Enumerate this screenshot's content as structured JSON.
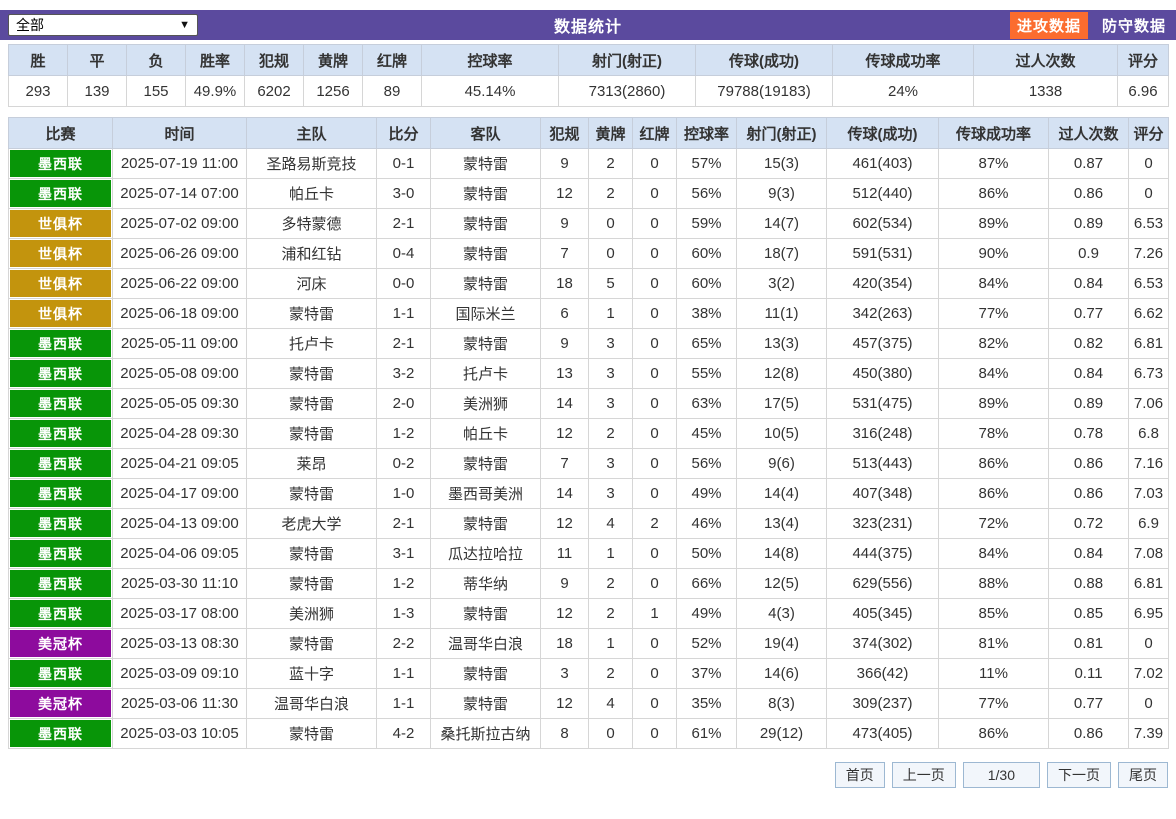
{
  "topbar": {
    "filter_value": "全部",
    "title": "数据统计",
    "attack_button": "进攻数据",
    "defense_button": "防守数据"
  },
  "colors": {
    "bar_purple": "#5b4a9e",
    "attack_orange": "#fb6c2f",
    "header_blue": "#d5e2f3",
    "league_green": "#089508",
    "league_gold": "#c3940d",
    "league_purple": "#8d0b9d"
  },
  "summary": {
    "headers": [
      "胜",
      "平",
      "负",
      "胜率",
      "犯规",
      "黄牌",
      "红牌",
      "控球率",
      "射门(射正)",
      "传球(成功)",
      "传球成功率",
      "过人次数",
      "评分"
    ],
    "values": [
      "293",
      "139",
      "155",
      "49.9%",
      "6202",
      "1256",
      "89",
      "45.14%",
      "7313(2860)",
      "79788(19183)",
      "24%",
      "1338",
      "6.96"
    ]
  },
  "matches": {
    "headers": [
      "比赛",
      "时间",
      "主队",
      "比分",
      "客队",
      "犯规",
      "黄牌",
      "红牌",
      "控球率",
      "射门(射正)",
      "传球(成功)",
      "传球成功率",
      "过人次数",
      "评分"
    ],
    "rows": [
      {
        "league": "墨西联",
        "league_color": "green",
        "cells": [
          "2025-07-19 11:00",
          "圣路易斯竞技",
          "0-1",
          "蒙特雷",
          "9",
          "2",
          "0",
          "57%",
          "15(3)",
          "461(403)",
          "87%",
          "0.87",
          "0"
        ]
      },
      {
        "league": "墨西联",
        "league_color": "green",
        "cells": [
          "2025-07-14 07:00",
          "帕丘卡",
          "3-0",
          "蒙特雷",
          "12",
          "2",
          "0",
          "56%",
          "9(3)",
          "512(440)",
          "86%",
          "0.86",
          "0"
        ]
      },
      {
        "league": "世俱杯",
        "league_color": "gold",
        "cells": [
          "2025-07-02 09:00",
          "多特蒙德",
          "2-1",
          "蒙特雷",
          "9",
          "0",
          "0",
          "59%",
          "14(7)",
          "602(534)",
          "89%",
          "0.89",
          "6.53"
        ]
      },
      {
        "league": "世俱杯",
        "league_color": "gold",
        "cells": [
          "2025-06-26 09:00",
          "浦和红钻",
          "0-4",
          "蒙特雷",
          "7",
          "0",
          "0",
          "60%",
          "18(7)",
          "591(531)",
          "90%",
          "0.9",
          "7.26"
        ]
      },
      {
        "league": "世俱杯",
        "league_color": "gold",
        "cells": [
          "2025-06-22 09:00",
          "河床",
          "0-0",
          "蒙特雷",
          "18",
          "5",
          "0",
          "60%",
          "3(2)",
          "420(354)",
          "84%",
          "0.84",
          "6.53"
        ]
      },
      {
        "league": "世俱杯",
        "league_color": "gold",
        "cells": [
          "2025-06-18 09:00",
          "蒙特雷",
          "1-1",
          "国际米兰",
          "6",
          "1",
          "0",
          "38%",
          "11(1)",
          "342(263)",
          "77%",
          "0.77",
          "6.62"
        ]
      },
      {
        "league": "墨西联",
        "league_color": "green",
        "cells": [
          "2025-05-11 09:00",
          "托卢卡",
          "2-1",
          "蒙特雷",
          "9",
          "3",
          "0",
          "65%",
          "13(3)",
          "457(375)",
          "82%",
          "0.82",
          "6.81"
        ]
      },
      {
        "league": "墨西联",
        "league_color": "green",
        "cells": [
          "2025-05-08 09:00",
          "蒙特雷",
          "3-2",
          "托卢卡",
          "13",
          "3",
          "0",
          "55%",
          "12(8)",
          "450(380)",
          "84%",
          "0.84",
          "6.73"
        ]
      },
      {
        "league": "墨西联",
        "league_color": "green",
        "cells": [
          "2025-05-05 09:30",
          "蒙特雷",
          "2-0",
          "美洲狮",
          "14",
          "3",
          "0",
          "63%",
          "17(5)",
          "531(475)",
          "89%",
          "0.89",
          "7.06"
        ]
      },
      {
        "league": "墨西联",
        "league_color": "green",
        "cells": [
          "2025-04-28 09:30",
          "蒙特雷",
          "1-2",
          "帕丘卡",
          "12",
          "2",
          "0",
          "45%",
          "10(5)",
          "316(248)",
          "78%",
          "0.78",
          "6.8"
        ]
      },
      {
        "league": "墨西联",
        "league_color": "green",
        "cells": [
          "2025-04-21 09:05",
          "莱昂",
          "0-2",
          "蒙特雷",
          "7",
          "3",
          "0",
          "56%",
          "9(6)",
          "513(443)",
          "86%",
          "0.86",
          "7.16"
        ]
      },
      {
        "league": "墨西联",
        "league_color": "green",
        "cells": [
          "2025-04-17 09:00",
          "蒙特雷",
          "1-0",
          "墨西哥美洲",
          "14",
          "3",
          "0",
          "49%",
          "14(4)",
          "407(348)",
          "86%",
          "0.86",
          "7.03"
        ]
      },
      {
        "league": "墨西联",
        "league_color": "green",
        "cells": [
          "2025-04-13 09:00",
          "老虎大学",
          "2-1",
          "蒙特雷",
          "12",
          "4",
          "2",
          "46%",
          "13(4)",
          "323(231)",
          "72%",
          "0.72",
          "6.9"
        ]
      },
      {
        "league": "墨西联",
        "league_color": "green",
        "cells": [
          "2025-04-06 09:05",
          "蒙特雷",
          "3-1",
          "瓜达拉哈拉",
          "11",
          "1",
          "0",
          "50%",
          "14(8)",
          "444(375)",
          "84%",
          "0.84",
          "7.08"
        ]
      },
      {
        "league": "墨西联",
        "league_color": "green",
        "cells": [
          "2025-03-30 11:10",
          "蒙特雷",
          "1-2",
          "蒂华纳",
          "9",
          "2",
          "0",
          "66%",
          "12(5)",
          "629(556)",
          "88%",
          "0.88",
          "6.81"
        ]
      },
      {
        "league": "墨西联",
        "league_color": "green",
        "cells": [
          "2025-03-17 08:00",
          "美洲狮",
          "1-3",
          "蒙特雷",
          "12",
          "2",
          "1",
          "49%",
          "4(3)",
          "405(345)",
          "85%",
          "0.85",
          "6.95"
        ]
      },
      {
        "league": "美冠杯",
        "league_color": "purple",
        "cells": [
          "2025-03-13 08:30",
          "蒙特雷",
          "2-2",
          "温哥华白浪",
          "18",
          "1",
          "0",
          "52%",
          "19(4)",
          "374(302)",
          "81%",
          "0.81",
          "0"
        ]
      },
      {
        "league": "墨西联",
        "league_color": "green",
        "cells": [
          "2025-03-09 09:10",
          "蓝十字",
          "1-1",
          "蒙特雷",
          "3",
          "2",
          "0",
          "37%",
          "14(6)",
          "366(42)",
          "11%",
          "0.11",
          "7.02"
        ]
      },
      {
        "league": "美冠杯",
        "league_color": "purple",
        "cells": [
          "2025-03-06 11:30",
          "温哥华白浪",
          "1-1",
          "蒙特雷",
          "12",
          "4",
          "0",
          "35%",
          "8(3)",
          "309(237)",
          "77%",
          "0.77",
          "0"
        ]
      },
      {
        "league": "墨西联",
        "league_color": "green",
        "cells": [
          "2025-03-03 10:05",
          "蒙特雷",
          "4-2",
          "桑托斯拉古纳",
          "8",
          "0",
          "0",
          "61%",
          "29(12)",
          "473(405)",
          "86%",
          "0.86",
          "7.39"
        ]
      }
    ]
  },
  "pagination": {
    "first": "首页",
    "prev": "上一页",
    "page": "1/30",
    "next": "下一页",
    "last": "尾页"
  }
}
